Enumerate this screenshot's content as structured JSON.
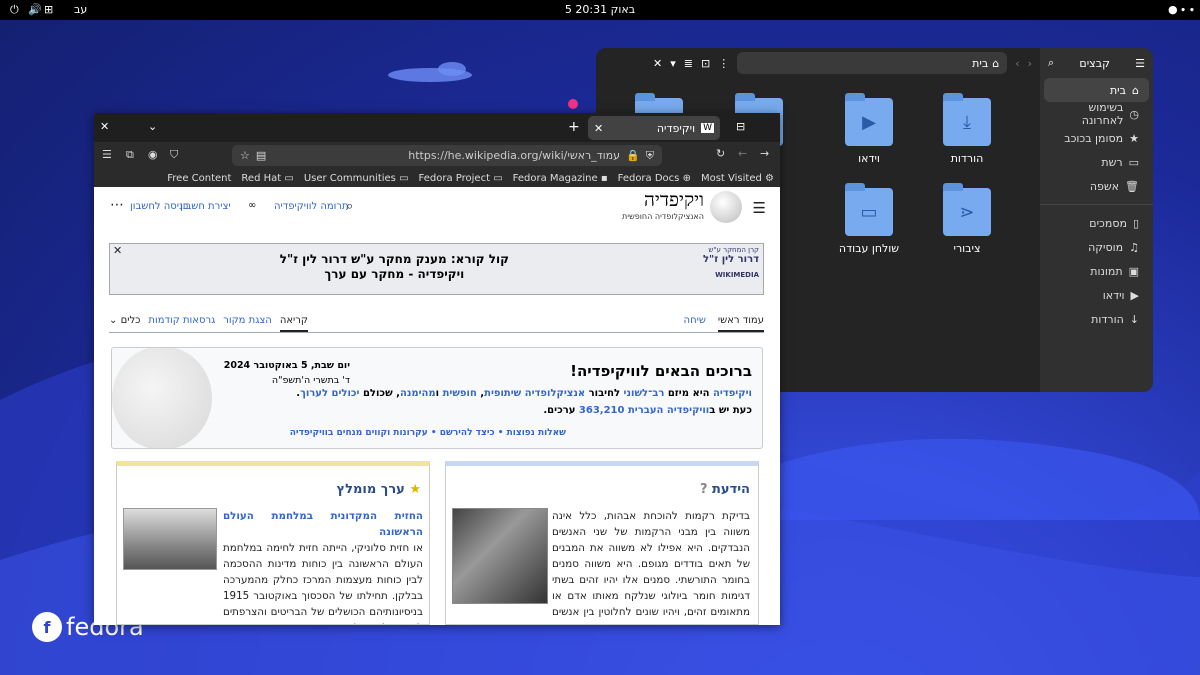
{
  "topbar": {
    "clock": "5 באוק  20:31",
    "lang": "עב"
  },
  "files": {
    "title": "קבצים",
    "path": "בית",
    "sidebar": [
      {
        "label": "בית",
        "icon": "home-icon",
        "active": true
      },
      {
        "label": "בשימוש לאחרונה",
        "icon": "clock-icon"
      },
      {
        "label": "מסומן בכוכב",
        "icon": "star-icon"
      },
      {
        "label": "רשת",
        "icon": "network-icon"
      },
      {
        "label": "אשפה",
        "icon": "trash-icon"
      },
      {
        "label": "מסמכים",
        "icon": "document-icon"
      },
      {
        "label": "מוסיקה",
        "icon": "music-icon"
      },
      {
        "label": "תמונות",
        "icon": "image-icon"
      },
      {
        "label": "וידאו",
        "icon": "video-icon"
      },
      {
        "label": "הורדות",
        "icon": "download-icon"
      }
    ],
    "folders": [
      "הורדות",
      "וידאו",
      "ציבורי",
      "שולחן עבודה"
    ]
  },
  "browser": {
    "tab_title": "ויקיפדיה",
    "url": "https://he.wikipedia.org/wiki/עמוד_ראשי",
    "bookmarks": [
      "Free Content",
      "Red Hat",
      "User Communities",
      "Fedora Project",
      "Fedora Magazine",
      "Fedora Docs",
      "Most Visited"
    ]
  },
  "wiki": {
    "logo_name": "ויקיפדיה",
    "logo_sub": "האנציקלופדיה החופשית",
    "donate": "תרומה לוויקיפדיה",
    "create_account": "יצירת חשבון",
    "login": "כניסה לחשבון",
    "banner_logo_line1": "קרן המחקר ע\"ש",
    "banner_logo_line2": "דרור לין ז\"ל",
    "banner_logo_line3": "WIKIMEDIA",
    "banner_line1": "קול קורא: מענק מחקר ע\"ש דרור לין ז\"ל",
    "banner_line2": "ויקיפדיה - מחקר עם ערך",
    "tabs_right": [
      "עמוד ראשי",
      "שיחה"
    ],
    "tabs_left": [
      "קריאה",
      "הצגת מקור",
      "גרסאות קודמות",
      "כלים"
    ],
    "welcome_title": "ברוכים הבאים לוויקיפדיה!",
    "welcome_line1_a": "ויקיפדיה",
    "welcome_line1_b": " היא מיזם ",
    "welcome_line1_c": "רב־לשוני",
    "welcome_line1_d": " לחיבור ",
    "welcome_line1_e": "אנציקלופדיה שיתופית",
    "welcome_line1_f": ", ",
    "welcome_line1_g": "חופשית",
    "welcome_line1_h": " ו",
    "welcome_line1_i": "מהימנה",
    "welcome_line1_j": ", שכולם ",
    "welcome_line1_k": "יכולים לערוך",
    "welcome_line1_l": ".",
    "welcome_line2_a": "כעת יש ב",
    "welcome_line2_b": "וויקיפדיה העברית 363,210",
    "welcome_line2_c": " ערכים.",
    "welcome_links": "שאלות נפוצות • כיצד להירשם • עקרונות וקווים מנחים בוויקיפדיה",
    "date1": "יום שבת, 5 באוקטובר 2024",
    "date2": "ד' בתשרי ה'תשפ\"ה",
    "did_you_know_title": "הידעת",
    "did_you_know_text": "בדיקת רקמות להוכחת אבהות, כלל אינה משווה בין מבני הרקמות של שני האנשים הנבדקים. היא אפילו לא משווה את המבנים של תאים בודדים מגופם. היא משווה סמנים בחומר התורשתי. סמנים אלו יהיו זהים בשתי דגימות חומר ביולוגי שנלקח מאותו אדם או מתאומים זהים, ויהיו שונים לחלוטין בין אנשים חסרי קרבה",
    "featured_title": "ערך מומלץ",
    "featured_link": "החזית המקדונית במלחמת העולם הראשונה",
    "featured_text": "או חזית סלוניקי, הייתה חזית לחימה במלחמת העולם הראשונה בין כוחות מדינות ההסכמה לבין כוחות מעצמות המרכז כחלק מהמערכה בבלקן. תחילתו של הסכסוך באוקטובר 1915 בניסיונותיהם הכושלים של הבריטים והצרפתים להגן על ממלכת סרביה מכיבוש. הכרעת המערכה על סרביה לטובת מעצמות המרכז הובילה"
  },
  "desktop": {
    "brand": "fedora"
  }
}
